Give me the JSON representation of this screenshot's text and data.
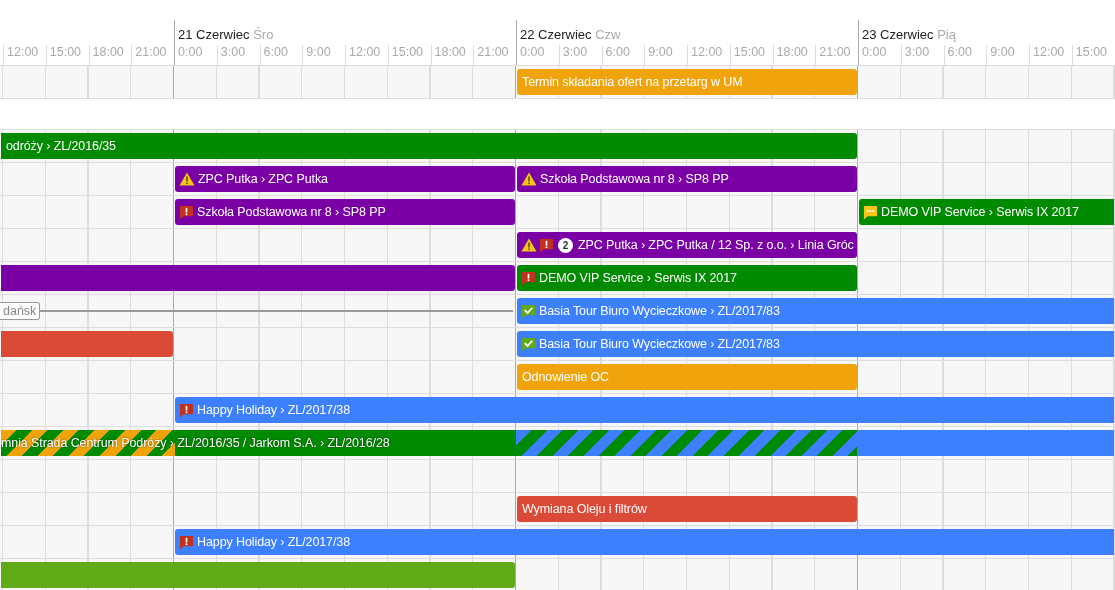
{
  "days": [
    {
      "hours": [
        "12:00",
        "15:00",
        "18:00",
        "21:00"
      ]
    },
    {
      "date": "21 Czerwiec",
      "weekday": "Śro",
      "hours": [
        "0:00",
        "3:00",
        "6:00",
        "9:00",
        "12:00",
        "15:00",
        "18:00",
        "21:00"
      ]
    },
    {
      "date": "22 Czerwiec",
      "weekday": "Czw",
      "hours": [
        "0:00",
        "3:00",
        "6:00",
        "9:00",
        "12:00",
        "15:00",
        "18:00",
        "21:00"
      ]
    },
    {
      "date": "23 Czerwiec",
      "weekday": "Pią",
      "hours": [
        "0:00",
        "3:00",
        "6:00",
        "9:00",
        "12:00",
        "15:00"
      ]
    }
  ],
  "rows": [
    {
      "kind": "lane",
      "cells": [
        {
          "kind": "empty"
        },
        {
          "kind": "empty"
        },
        {
          "kind": "event",
          "title": "Termin składania ofert na przetarg w UM",
          "color": "#f0a30a"
        },
        {
          "kind": "empty"
        }
      ]
    },
    {
      "kind": "gap"
    },
    {
      "kind": "lane",
      "cells": [
        {
          "kind": "event",
          "title": "odróży › ZL/2016/35",
          "color": "#008a00"
        },
        {
          "kind": "continued"
        },
        {
          "kind": "continued"
        },
        {
          "kind": "empty"
        }
      ]
    },
    {
      "kind": "lane",
      "cells": [
        {
          "kind": "empty"
        },
        {
          "kind": "event",
          "title": "ZPC Putka › ZPC Putka",
          "color": "#7a00a5",
          "icons": [
            {
              "kind": "warning"
            }
          ]
        },
        {
          "kind": "event",
          "title": "Szkoła Podstawowa nr 8 › SP8 PP",
          "color": "#7a00a5",
          "icons": [
            {
              "kind": "warning"
            }
          ]
        },
        {
          "kind": "empty"
        }
      ]
    },
    {
      "kind": "lane",
      "cells": [
        {
          "kind": "empty"
        },
        {
          "kind": "event",
          "title": "Szkoła Podstawowa nr 8 › SP8 PP",
          "color": "#7a00a5",
          "icons": [
            {
              "kind": "error"
            }
          ]
        },
        {
          "kind": "empty"
        },
        {
          "kind": "event",
          "title": "DEMO VIP Service › Serwis IX 2017",
          "color": "#008a00",
          "icons": [
            {
              "kind": "comment"
            }
          ]
        }
      ]
    },
    {
      "kind": "lane",
      "cells": [
        {
          "kind": "empty"
        },
        {
          "kind": "empty"
        },
        {
          "kind": "event",
          "title": "ZPC Putka › ZPC Putka / 12 Sp. z o.o. › Linia Gróc",
          "color": "#7a00a5",
          "icons": [
            {
              "kind": "warning"
            },
            {
              "kind": "error"
            }
          ],
          "badge": "2"
        },
        {
          "kind": "empty"
        }
      ]
    },
    {
      "kind": "lane",
      "cells": [
        {
          "kind": "event",
          "color": "#7a00a5"
        },
        {
          "kind": "continued"
        },
        {
          "kind": "event",
          "title": "DEMO VIP Service › Serwis IX 2017",
          "color": "#008a00",
          "icons": [
            {
              "kind": "error"
            }
          ]
        },
        {
          "kind": "empty"
        }
      ]
    },
    {
      "kind": "lane",
      "cells": [
        {
          "kind": "pin",
          "label": "dańsk"
        },
        {
          "kind": "continued"
        },
        {
          "kind": "event",
          "title": "Basia Tour Biuro Wycieczkowe › ZL/2017/83",
          "color": "#3d80ff",
          "icons": [
            {
              "kind": "check"
            }
          ]
        },
        {
          "kind": "continued"
        }
      ]
    },
    {
      "kind": "lane",
      "cells": [
        {
          "kind": "event",
          "color": "#db4937"
        },
        {
          "kind": "empty"
        },
        {
          "kind": "event",
          "title": "Basia Tour Biuro Wycieczkowe › ZL/2017/83",
          "color": "#3d80ff",
          "icons": [
            {
              "kind": "check"
            }
          ]
        },
        {
          "kind": "continued"
        }
      ]
    },
    {
      "kind": "lane",
      "cells": [
        {
          "kind": "empty"
        },
        {
          "kind": "empty"
        },
        {
          "kind": "event",
          "title": "Odnowienie OC",
          "color": "#f0a30a"
        },
        {
          "kind": "empty"
        }
      ]
    },
    {
      "kind": "lane",
      "cells": [
        {
          "kind": "empty"
        },
        {
          "kind": "event",
          "title": "Happy Holiday › ZL/2017/38",
          "color": "#3d80ff",
          "icons": [
            {
              "kind": "error"
            }
          ]
        },
        {
          "kind": "continued"
        },
        {
          "kind": "continued"
        }
      ]
    },
    {
      "kind": "lane",
      "cells": [
        {
          "kind": "event",
          "title": "mnia Strada Centrum Podróży › ZL/2016/35 / Jarkom S.A. › ZL/2016/28",
          "color": "#008a00",
          "stripes": {
            "color": "#f0a30a"
          }
        },
        {
          "kind": "continued",
          "color": "#008a00"
        },
        {
          "kind": "continued",
          "color": "#008a00",
          "stripes": {
            "color": "#3d80ff"
          }
        },
        {
          "kind": "continued",
          "color": "#3d80ff"
        }
      ]
    },
    {
      "kind": "lane",
      "cells": [
        {
          "kind": "empty"
        },
        {
          "kind": "empty"
        },
        {
          "kind": "empty"
        },
        {
          "kind": "empty"
        }
      ]
    },
    {
      "kind": "lane",
      "cells": [
        {
          "kind": "empty"
        },
        {
          "kind": "empty"
        },
        {
          "kind": "event",
          "title": "Wymiana Oleju i filtrów",
          "color": "#db4937"
        },
        {
          "kind": "empty"
        }
      ]
    },
    {
      "kind": "lane",
      "cells": [
        {
          "kind": "empty"
        },
        {
          "kind": "event",
          "title": "Happy Holiday › ZL/2017/38",
          "color": "#3d80ff",
          "icons": [
            {
              "kind": "error"
            }
          ]
        },
        {
          "kind": "continued"
        },
        {
          "kind": "continued"
        }
      ]
    },
    {
      "kind": "lane",
      "cells": [
        {
          "kind": "event",
          "color": "#60a917"
        },
        {
          "kind": "continued"
        },
        {
          "kind": "empty"
        },
        {
          "kind": "empty"
        }
      ]
    }
  ]
}
